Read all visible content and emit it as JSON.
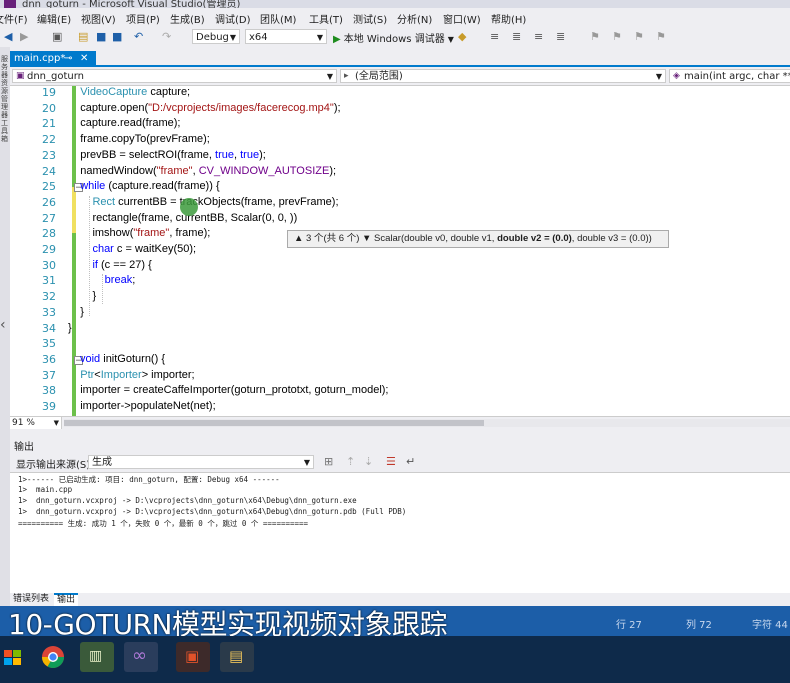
{
  "window": {
    "title": "dnn_goturn - Microsoft Visual Studio(管理员)"
  },
  "menu": {
    "items": [
      "文件(F)",
      "编辑(E)",
      "视图(V)",
      "项目(P)",
      "生成(B)",
      "调试(D)",
      "团队(M)",
      "工具(T)",
      "测试(S)",
      "分析(N)",
      "窗口(W)",
      "帮助(H)"
    ]
  },
  "toolbar": {
    "config": "Debug",
    "platform": "x64",
    "run_label": "本地 Windows 调试器"
  },
  "left_rail": {
    "text": "服务器资源管理器 工具箱"
  },
  "tabs": {
    "active": "main.cpp*"
  },
  "navbar": {
    "project": "dnn_goturn",
    "scope": "(全局范围)",
    "member": "main(int argc, char ** arg"
  },
  "editor": {
    "line_numbers": [
      "19",
      "20",
      "21",
      "22",
      "23",
      "24",
      "25",
      "26",
      "27",
      "28",
      "29",
      "30",
      "31",
      "32",
      "33",
      "34",
      "35",
      "36",
      "37",
      "38",
      "39"
    ],
    "tooltip": {
      "prefix": "▲ 3 个(共 6 个) ▼ Scalar(double v0, double v1, ",
      "bold": "double v2 = (0.0)",
      "suffix": ", double v3 = (0.0))"
    }
  },
  "zoom": {
    "level": "91 %"
  },
  "output": {
    "title": "输出",
    "source_label": "显示输出来源(S):",
    "source_value": "生成",
    "lines": [
      "1>------ 已启动生成: 项目: dnn_goturn, 配置: Debug x64 ------",
      "1>  main.cpp",
      "1>  dnn_goturn.vcxproj -> D:\\vcprojects\\dnn_goturn\\x64\\Debug\\dnn_goturn.exe",
      "1>  dnn_goturn.vcxproj -> D:\\vcprojects\\dnn_goturn\\x64\\Debug\\dnn_goturn.pdb (Full PDB)",
      "========== 生成: 成功 1 个，失败 0 个，最新 0 个，跳过 0 个 =========="
    ]
  },
  "bottom_tabs": {
    "errors": "错误列表",
    "output": "输出"
  },
  "status": {
    "caption": "10-GOTURN模型实现视频对象跟踪",
    "row": "行 27",
    "col": "列 72",
    "char": "字符 44"
  },
  "colors": {
    "accent": "#007acc",
    "status_bar": "#1c5ea8",
    "keyword": "#0000ff",
    "type": "#2b91af",
    "string": "#a31515",
    "macro": "#6f008a",
    "vs_purple": "#68217a"
  }
}
